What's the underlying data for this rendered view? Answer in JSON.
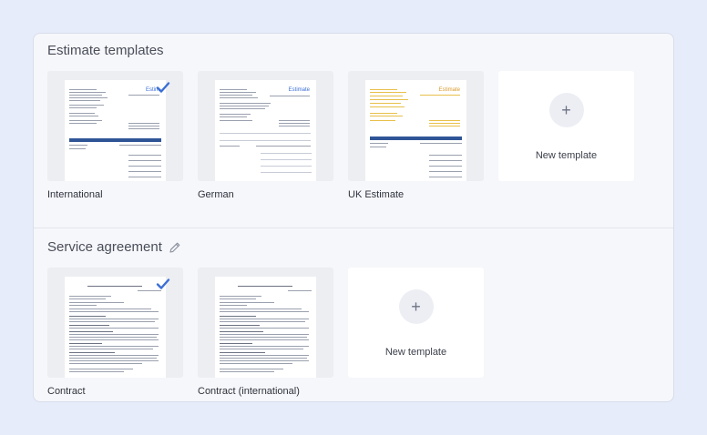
{
  "sections": [
    {
      "title": "Estimate templates",
      "templates": [
        {
          "label": "International",
          "selected": true,
          "thumb_title": "Estim"
        },
        {
          "label": "German",
          "selected": false,
          "thumb_title": "Estimate"
        },
        {
          "label": "UK Estimate",
          "selected": false,
          "thumb_title": "Estimate"
        }
      ],
      "new_label": "New template",
      "plus": "+"
    },
    {
      "title": "Service agreement",
      "edit_icon": "pencil-icon",
      "templates": [
        {
          "label": "Contract",
          "selected": true
        },
        {
          "label": "Contract (international)",
          "selected": false
        }
      ],
      "new_label": "New template",
      "plus": "+"
    }
  ],
  "colors": {
    "accent": "#2f5597",
    "check": "#3b6fd6",
    "estimate_title_blue": "#3b6fd6",
    "estimate_title_orange": "#d99a2b",
    "background": "#e7ecfb",
    "panel": "#f6f7fb"
  },
  "icons": {
    "check": "checkmark-icon",
    "plus": "plus-icon",
    "edit": "pencil-icon"
  }
}
